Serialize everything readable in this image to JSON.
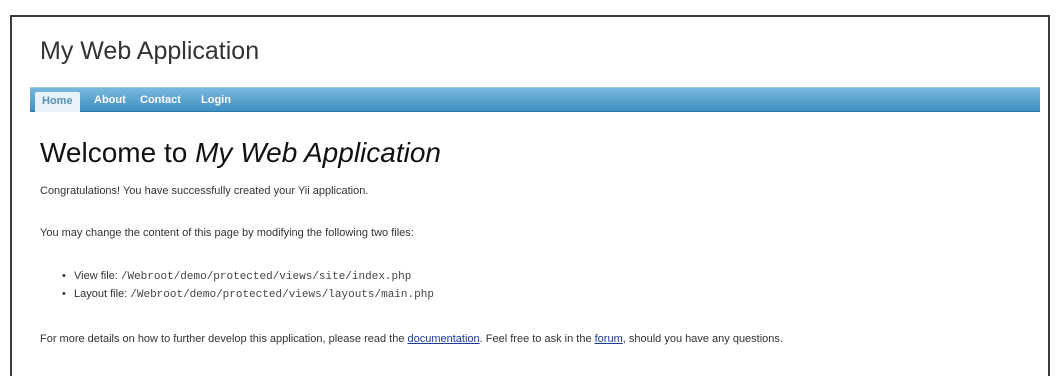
{
  "site": {
    "title": "My Web Application"
  },
  "nav": {
    "items": [
      {
        "label": "Home",
        "active": true
      },
      {
        "label": "About",
        "active": false
      },
      {
        "label": "Contact",
        "active": false
      },
      {
        "label": "Login",
        "active": false
      }
    ]
  },
  "content": {
    "heading_prefix": "Welcome to ",
    "heading_emphasis": "My Web Application",
    "congrats": "Congratulations! You have successfully created your Yii application.",
    "change_intro": "You may change the content of this page by modifying the following two files:",
    "files": [
      {
        "label": "View file: ",
        "path": "/Webroot/demo/protected/views/site/index.php"
      },
      {
        "label": "Layout file: ",
        "path": "/Webroot/demo/protected/views/layouts/main.php"
      }
    ],
    "details_prefix": "For more details on how to further develop this application, please read the ",
    "documentation_link": "documentation",
    "details_middle": ". Feel free to ask in the ",
    "forum_link": "forum",
    "details_suffix": ", should you have any questions."
  },
  "colors": {
    "navbar_top": "#79b8dd",
    "navbar_bottom": "#3f8fc2",
    "link": "#1a3a9c"
  }
}
